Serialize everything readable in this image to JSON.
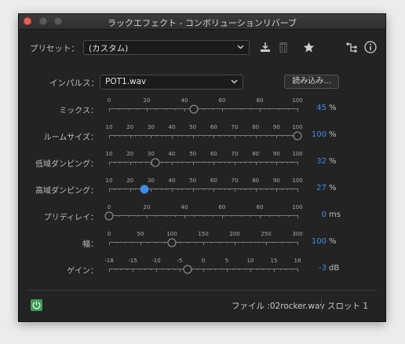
{
  "window": {
    "title": "ラックエフェクト - コンボリューションリバーブ"
  },
  "preset": {
    "label": "プリセット：",
    "value": "(カスタム)"
  },
  "impulse": {
    "label": "インパルス：",
    "value": "POT1.wav",
    "load_button": "読み込み..."
  },
  "params": [
    {
      "label": "ミックス：",
      "ticks": [
        "0",
        "20",
        "40",
        "60",
        "80",
        "100"
      ],
      "min": 0,
      "max": 100,
      "value": 45,
      "display": "45",
      "unit": "%",
      "active": false
    },
    {
      "label": "ルームサイズ：",
      "ticks": [
        "10",
        "20",
        "30",
        "40",
        "50",
        "60",
        "70",
        "80",
        "90",
        "100"
      ],
      "min": 10,
      "max": 100,
      "value": 100,
      "display": "100",
      "unit": "%",
      "active": false
    },
    {
      "label": "低域ダンピング：",
      "ticks": [
        "10",
        "20",
        "30",
        "40",
        "50",
        "60",
        "70",
        "80",
        "90",
        "100"
      ],
      "min": 10,
      "max": 100,
      "value": 32,
      "display": "32",
      "unit": "%",
      "active": false
    },
    {
      "label": "高域ダンピング：",
      "ticks": [
        "10",
        "20",
        "30",
        "40",
        "50",
        "60",
        "70",
        "80",
        "90",
        "100"
      ],
      "min": 10,
      "max": 100,
      "value": 27,
      "display": "27",
      "unit": "%",
      "active": true
    },
    {
      "label": "プリディレイ：",
      "ticks": [
        "0",
        "20",
        "40",
        "60",
        "80",
        "100"
      ],
      "min": 0,
      "max": 100,
      "value": 0,
      "display": "0",
      "unit": "ms",
      "active": false
    },
    {
      "label": "幅：",
      "ticks": [
        "0",
        "50",
        "100",
        "150",
        "200",
        "250",
        "300"
      ],
      "min": 0,
      "max": 300,
      "value": 100,
      "display": "100",
      "unit": "%",
      "active": false
    },
    {
      "label": "ゲイン：",
      "ticks": [
        "-18",
        "-15",
        "-10",
        "-5",
        "0",
        "5",
        "10",
        "15",
        "18"
      ],
      "min": -18,
      "max": 18,
      "value": -3,
      "display": "-3",
      "unit": "dB",
      "active": false
    }
  ],
  "footer": {
    "file": "ファイル :02rocker.wav",
    "slot": "スロット 1"
  },
  "colors": {
    "accent": "#3e8ee3",
    "power": "#3f9a5a"
  }
}
